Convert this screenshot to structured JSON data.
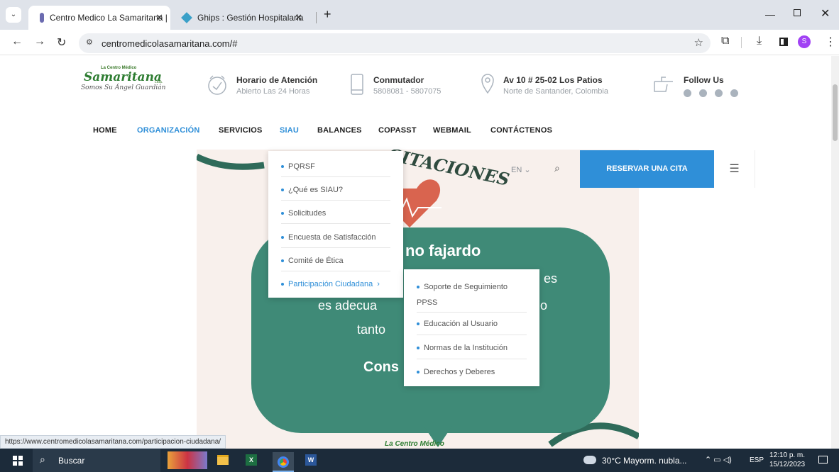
{
  "browser": {
    "tabs": [
      {
        "title": "Centro Medico La Samaritana |",
        "active": true
      },
      {
        "title": "Ghips : Gestión Hospitalaria",
        "active": false
      }
    ],
    "new_tab_symbol": "+",
    "url": "centromedicolasamaritana.com/#",
    "status_url": "https://www.centromedicolasamaritana.com/participacion-ciudadana/",
    "profile_initial": "S"
  },
  "site": {
    "logo": {
      "small": "La Centro Médico",
      "brand": "Samaritana",
      "ltda": "Ltda.",
      "tagline": "Somos Su Ángel Guardián"
    },
    "info": [
      {
        "title": "Horario de Atención",
        "sub": "Abierto Las 24 Horas",
        "icon": "clock-icon"
      },
      {
        "title": "Conmutador",
        "sub": "5808081 - 5807075",
        "icon": "phone-icon"
      },
      {
        "title": "Av 10 # 25-02 Los Patios",
        "sub": "Norte de Santander, Colombia",
        "icon": "location-icon"
      }
    ],
    "follow": {
      "title": "Follow Us"
    },
    "nav": [
      "HOME",
      "ORGANIZACIÓN",
      "SERVICIOS",
      "SIAU",
      "BALANCES",
      "COPASST",
      "WEBMAIL",
      "CONTÁCTENOS"
    ],
    "active_nav": "ORGANIZACIÓN",
    "lang": "EN",
    "cta": "RESERVAR UNA CITA",
    "dropdown_siau": [
      "PQRSF",
      "¿Qué es SIAU?",
      "Solicitudes",
      "Encuesta de Satisfacción",
      "Comité de Ética",
      "Participación Ciudadana"
    ],
    "dropdown_sub": [
      "Soporte de Seguimiento PPSS",
      "Educación al Usuario",
      "Normas de la Institución",
      "Derechos y Deberes"
    ],
    "hero": {
      "arc_text": "CITACIONES",
      "heading": "no fajardo",
      "line1": "es",
      "line2": "es adecua",
      "line2b": "o",
      "line3": "tanto",
      "bold": "Cons",
      "footer_small": "La Centro Médico"
    }
  },
  "taskbar": {
    "search": "Buscar",
    "weather": "30°C  Mayorm. nubla...",
    "lang": "ESP",
    "time": "12:10 p. m.",
    "date": "15/12/2023"
  }
}
